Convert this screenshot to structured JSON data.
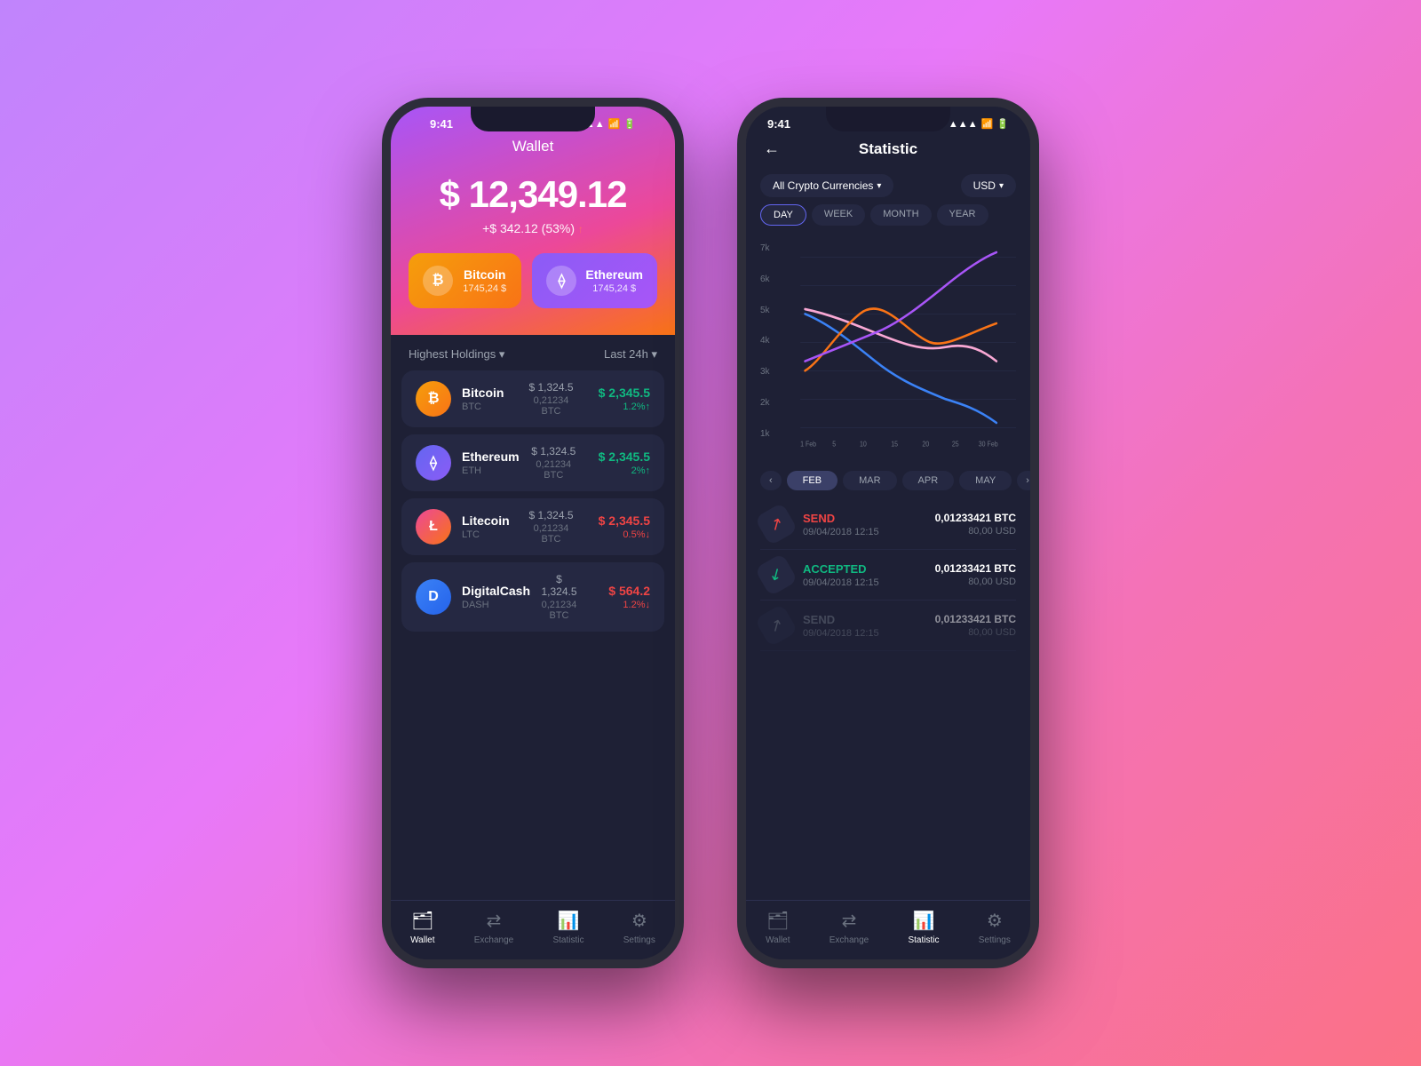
{
  "phone1": {
    "status_time": "9:41",
    "title": "Wallet",
    "balance": "$ 12,349.12",
    "change": "+$ 342.12 (53%)",
    "change_arrow": "↑",
    "btc_card": {
      "name": "Bitcoin",
      "value": "1745,24 $",
      "symbol": "₿"
    },
    "eth_card": {
      "name": "Ethereum",
      "value": "1745,24 $",
      "symbol": "⟠"
    },
    "holdings_title": "Highest Holdings ▾",
    "holdings_filter": "Last 24h ▾",
    "coins": [
      {
        "name": "Bitcoin",
        "symbol": "BTC",
        "icon": "₿",
        "icon_class": "btc-icon",
        "price": "$ 1,324.5",
        "btc_val": "0,21234 BTC",
        "change": "$ 2,345.5",
        "pct": "1.2%↑",
        "dir": "up"
      },
      {
        "name": "Ethereum",
        "symbol": "ETH",
        "icon": "⟠",
        "icon_class": "eth-icon",
        "price": "$ 1,324.5",
        "btc_val": "0,21234 BTC",
        "change": "$ 2,345.5",
        "pct": "2%↑",
        "dir": "up"
      },
      {
        "name": "Litecoin",
        "symbol": "LTC",
        "icon": "Ł",
        "icon_class": "ltc-icon",
        "price": "$ 1,324.5",
        "btc_val": "0,21234 BTC",
        "change": "$ 2,345.5",
        "pct": "0.5%↓",
        "dir": "down"
      },
      {
        "name": "DigitalCash",
        "symbol": "DASH",
        "icon": "D",
        "icon_class": "dash-icon",
        "price": "$ 1,324.5",
        "btc_val": "0,21234 BTC",
        "change": "$ 564.2",
        "pct": "1.2%↓",
        "dir": "down"
      }
    ],
    "nav": [
      {
        "label": "Wallet",
        "icon": "🗂",
        "active": true
      },
      {
        "label": "Exchange",
        "icon": "⇄",
        "active": false
      },
      {
        "label": "Statistic",
        "icon": "📊",
        "active": false
      },
      {
        "label": "Settings",
        "icon": "⚙",
        "active": false
      }
    ]
  },
  "phone2": {
    "status_time": "9:41",
    "back": "←",
    "title": "Statistic",
    "currency_filter": "All Crypto Currencies",
    "usd_filter": "USD",
    "time_filters": [
      "DAY",
      "WEEK",
      "MONTH",
      "YEAR"
    ],
    "active_time": "DAY",
    "chart": {
      "y_labels": [
        "7k",
        "6k",
        "5k",
        "4k",
        "3k",
        "2k",
        "1k"
      ],
      "x_labels": [
        "1 Feb",
        "5",
        "10",
        "15",
        "20",
        "25",
        "30 Feb"
      ]
    },
    "month_filters": [
      "FEB",
      "MAR",
      "APR",
      "MAY"
    ],
    "active_month": "FEB",
    "transactions": [
      {
        "type": "SEND",
        "type_class": "send",
        "date": "09/04/2018 12:15",
        "btc": "0,01233421 BTC",
        "usd": "80,00 USD",
        "icon": "↗",
        "icon_color": "#ef4444"
      },
      {
        "type": "ACCEPTED",
        "type_class": "accept",
        "date": "09/04/2018 12:15",
        "btc": "0,01233421 BTC",
        "usd": "80,00 USD",
        "icon": "↙",
        "icon_color": "#10b981"
      },
      {
        "type": "SEND",
        "type_class": "send",
        "date": "09/04/2018 12:15",
        "btc": "0,01233421 BTC",
        "usd": "80,00 USD",
        "icon": "↗",
        "icon_color": "#6b7280"
      }
    ],
    "nav": [
      {
        "label": "Wallet",
        "icon": "🗂",
        "active": false
      },
      {
        "label": "Exchange",
        "icon": "⇄",
        "active": false
      },
      {
        "label": "Statistic",
        "icon": "📊",
        "active": true
      },
      {
        "label": "Settings",
        "icon": "⚙",
        "active": false
      }
    ]
  }
}
